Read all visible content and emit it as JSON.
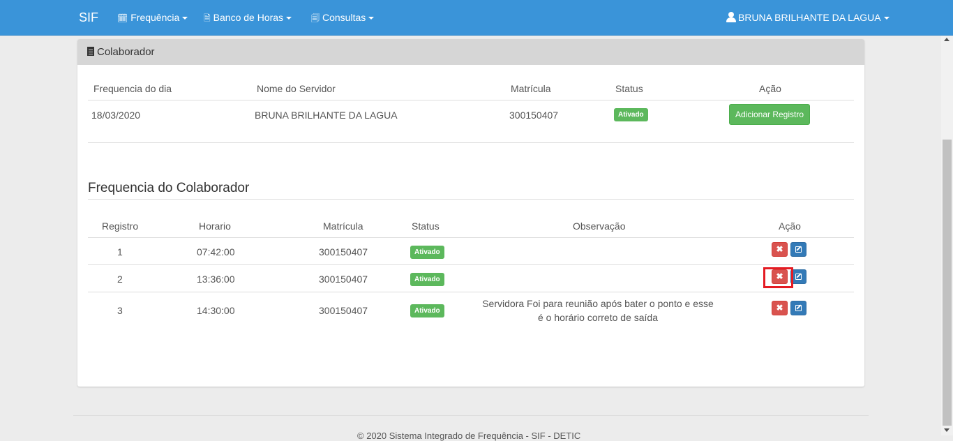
{
  "navbar": {
    "brand": "SIF",
    "menus": [
      {
        "label": "Frequência",
        "icon": "clock-calendar-icon"
      },
      {
        "label": "Banco de Horas",
        "icon": "document-icon"
      },
      {
        "label": "Consultas",
        "icon": "search-document-icon"
      }
    ],
    "user": "BRUNA BRILHANTE DA LAGUA"
  },
  "panel": {
    "title": "Colaborador",
    "headers": [
      "Frequencia do dia",
      "Nome do Servidor",
      "Matrícula",
      "Status",
      "Ação"
    ],
    "row": {
      "date": "18/03/2020",
      "name": "BRUNA BRILHANTE DA LAGUA",
      "matricula": "300150407",
      "status": "Ativado",
      "action_label": "Adicionar Registro"
    }
  },
  "frequencia": {
    "title": "Frequencia do Colaborador",
    "headers": [
      "Registro",
      "Horario",
      "Matrícula",
      "Status",
      "Observação",
      "Ação"
    ],
    "rows": [
      {
        "registro": "1",
        "horario": "07:42:00",
        "matricula": "300150407",
        "status": "Ativado",
        "observacao": ""
      },
      {
        "registro": "2",
        "horario": "13:36:00",
        "matricula": "300150407",
        "status": "Ativado",
        "observacao": ""
      },
      {
        "registro": "3",
        "horario": "14:30:00",
        "matricula": "300150407",
        "status": "Ativado",
        "observacao": "Servidora Foi para reunião após bater o ponto e esse é o horário correto de saída"
      }
    ]
  },
  "footer": {
    "text": "© 2020 Sistema Integrado de Frequência - SIF - DETIC"
  },
  "colors": {
    "navbar": "#3a94d9",
    "success": "#5cb85c",
    "danger": "#d9534f",
    "primary": "#337ab7",
    "highlight": "#e41b23"
  }
}
